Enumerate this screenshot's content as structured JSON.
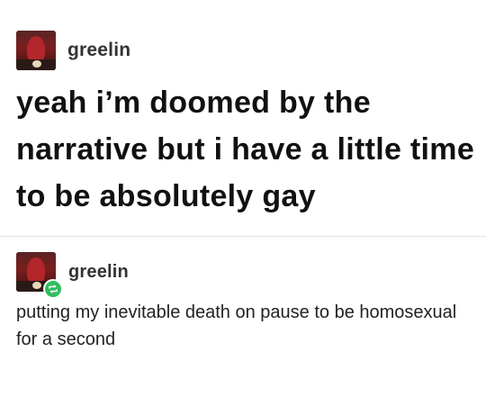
{
  "posts": [
    {
      "username": "greelin",
      "avatar_icon": "avatar-image",
      "body": "yeah i’m doomed by the narrative but i have a little time to be absolutely gay"
    },
    {
      "username": "greelin",
      "avatar_icon": "avatar-image",
      "badge_icon": "reblog-icon",
      "badge_color": "#2ebd5f",
      "body": "putting my inevitable death on pause to be homosexual for a second"
    }
  ]
}
